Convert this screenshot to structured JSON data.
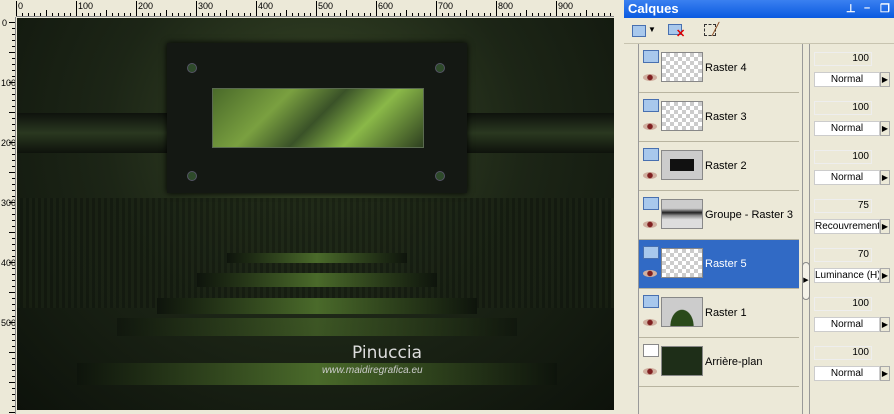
{
  "ruler": {
    "h_labels": [
      "0",
      "100",
      "200",
      "300",
      "400",
      "500",
      "600",
      "700",
      "800",
      "900"
    ],
    "v_labels": [
      "0",
      "100",
      "200",
      "300",
      "400",
      "500"
    ]
  },
  "canvas": {
    "signature": "Pinuccia",
    "url": "www.maidiregrafica.eu"
  },
  "panel": {
    "title": "Calques",
    "controls": {
      "pin": "⊥",
      "minimize": "–",
      "restore": "❐"
    },
    "toolbar": [
      {
        "icon": "new-layer-icon"
      },
      {
        "icon": "delete-layer-icon"
      },
      {
        "icon": "edit-selection-icon"
      }
    ],
    "layers": [
      {
        "name": "Raster 4",
        "opacity": "100",
        "blend": "Normal",
        "selected": false
      },
      {
        "name": "Raster 3",
        "opacity": "100",
        "blend": "Normal",
        "selected": false
      },
      {
        "name": "Raster 2",
        "opacity": "100",
        "blend": "Normal",
        "selected": false
      },
      {
        "name": "Groupe - Raster 3",
        "opacity": "75",
        "blend": "Recouvrement",
        "selected": false
      },
      {
        "name": "Raster 5",
        "opacity": "70",
        "blend": "Luminance (H)",
        "selected": true
      },
      {
        "name": "Raster 1",
        "opacity": "100",
        "blend": "Normal",
        "selected": false
      },
      {
        "name": "Arrière-plan",
        "opacity": "100",
        "blend": "Normal",
        "selected": false
      }
    ]
  },
  "colors": {
    "title_bar": "#0a5ae0",
    "selection": "#316ac5",
    "panel_bg": "#ece9d8"
  }
}
